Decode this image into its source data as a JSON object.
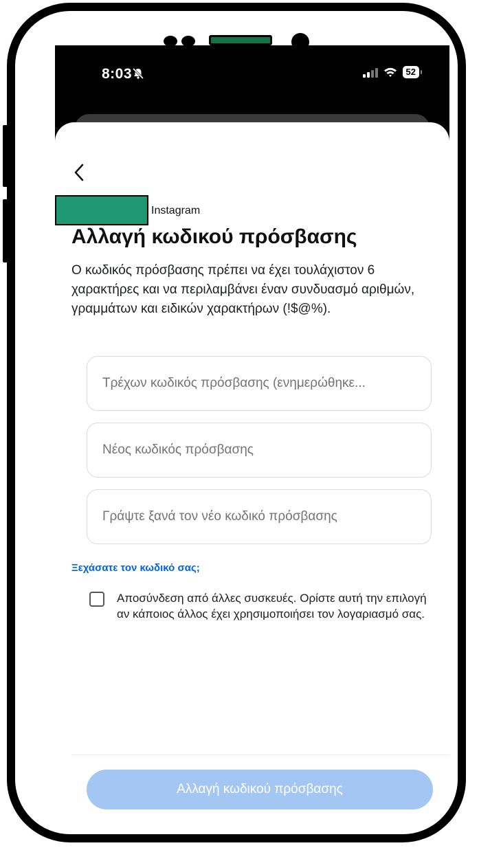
{
  "status_bar": {
    "time": "8:03",
    "battery": "52",
    "icons": [
      "bell-slash-icon",
      "cellular-signal-icon",
      "wifi-icon",
      "battery-icon"
    ]
  },
  "header": {
    "back_icon": "chevron-left-icon",
    "brand": "Instagram",
    "title": "Αλλαγή κωδικού πρόσβασης"
  },
  "description": "Ο κωδικός πρόσβασης πρέπει να έχει τουλάχιστον 6 χαρακτήρες και να περιλαμβάνει έναν συνδυασμό αριθμών, γραμμάτων και ειδικών χαρακτήρων (!$@%).",
  "form": {
    "current_password": {
      "value": "",
      "placeholder": "Τρέχων κωδικός πρόσβασης (ενημερώθηκε..."
    },
    "new_password": {
      "value": "",
      "placeholder": "Νέος κωδικός πρόσβασης"
    },
    "confirm_password": {
      "value": "",
      "placeholder": "Γράψτε ξανά τον νέο κωδικό πρόσβασης"
    },
    "forgot_link": "Ξεχάσατε τον κωδικό σας;",
    "logout_checkbox": {
      "checked": false,
      "label": "Αποσύνδεση από άλλες συσκευές. Ορίστε αυτή την επιλογή αν κάποιος άλλος έχει χρησιμοποιήσει τον λογαριασμό σας."
    },
    "submit_label": "Αλλαγή κωδικού πρόσβασης"
  },
  "colors": {
    "link": "#0064e0",
    "submit_disabled": "#a4c6f2",
    "redaction": "#1f9771"
  }
}
